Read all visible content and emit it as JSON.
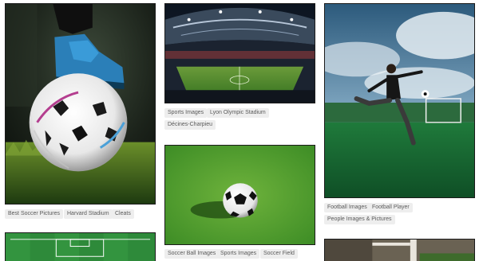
{
  "gallery": {
    "columns": [
      {
        "cards": [
          {
            "subject": "soccer player foot on ball at night on grass",
            "tags": [
              "Best Soccer Pictures",
              "Harvard Stadium",
              "Cleats"
            ]
          },
          {
            "subject": "top-down soccer field (partially visible)",
            "tags": []
          }
        ]
      },
      {
        "cards": [
          {
            "subject": "aerial view of illuminated stadium",
            "tags": [
              "Sports Images",
              "Lyon Olympic Stadium",
              "Décines-Charpieu"
            ]
          },
          {
            "subject": "soccer ball on green turf",
            "tags": [
              "Soccer Ball Images",
              "Sports Images",
              "Soccer Field"
            ]
          }
        ]
      },
      {
        "cards": [
          {
            "subject": "player kicking ball on pitch under cloudy sky",
            "tags": [
              "Football Images",
              "Football Player",
              "People Images & Pictures"
            ]
          },
          {
            "subject": "stadium with goal (partially visible)",
            "tags": []
          }
        ]
      }
    ]
  },
  "colors": {
    "tag_bg": "#eeeeee",
    "tag_text": "#5a5a5a",
    "grass": "#2f7d2c",
    "border": "#1b1b1b"
  }
}
